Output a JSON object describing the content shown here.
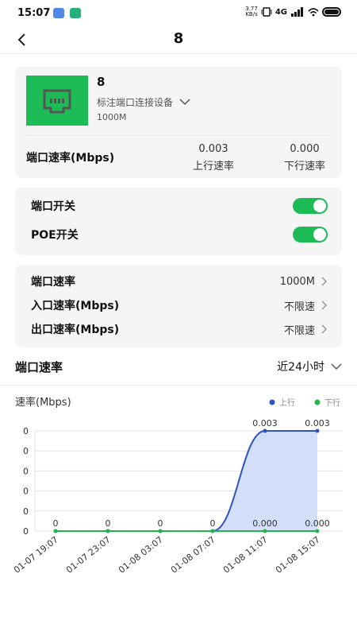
{
  "status_bar": {
    "time": "15:07",
    "net_speed_value": "3.77",
    "net_speed_unit": "KB/s",
    "network": "4G"
  },
  "nav": {
    "title": "8",
    "back_icon": "chevron-left-icon"
  },
  "device": {
    "name": "8",
    "annotate_label": "标注端口连接设备",
    "port_speed": "1000M",
    "thumbnail_icon": "ethernet-port-icon",
    "rate_label": "端口速率(Mbps)",
    "up_value": "0.003",
    "up_label": "上行速率",
    "down_value": "0.000",
    "down_label": "下行速率"
  },
  "switches": [
    {
      "label": "端口开关",
      "on": true
    },
    {
      "label": "POE开关",
      "on": true
    }
  ],
  "rate_settings": [
    {
      "label": "端口速率",
      "value": "1000M"
    },
    {
      "label": "入口速率(Mbps)",
      "value": "不限速"
    },
    {
      "label": "出口速率(Mbps)",
      "value": "不限速"
    }
  ],
  "section": {
    "title": "端口速率",
    "range": "近24小时"
  },
  "colors": {
    "accent_green": "#1cbb55",
    "upstream_blue": "#2f52c4",
    "upstream_fill": "#d3def9",
    "downstream_green": "#21b54b"
  },
  "chart_data": {
    "type": "area",
    "ylabel": "速率(Mbps)",
    "y_tick_labels": [
      "0",
      "0",
      "0",
      "0",
      "0",
      "0"
    ],
    "categories": [
      "01-07 19:07",
      "01-07 23:07",
      "01-08 03:07",
      "01-08 07:07",
      "01-08 11:07",
      "01-08 15:07"
    ],
    "series": [
      {
        "name": "上行",
        "values": [
          0,
          0,
          0,
          0,
          0.003,
          0.003
        ],
        "labels": [
          "0",
          "0",
          "0",
          "0",
          "0.003",
          "0.003"
        ]
      },
      {
        "name": "下行",
        "values": [
          0,
          0,
          0,
          0,
          0,
          0
        ],
        "labels": [
          "",
          "",
          "",
          "",
          "0.000",
          "0.000"
        ]
      }
    ],
    "ylim": [
      0,
      0.003
    ],
    "grid": true,
    "legend_position": "top-right"
  }
}
